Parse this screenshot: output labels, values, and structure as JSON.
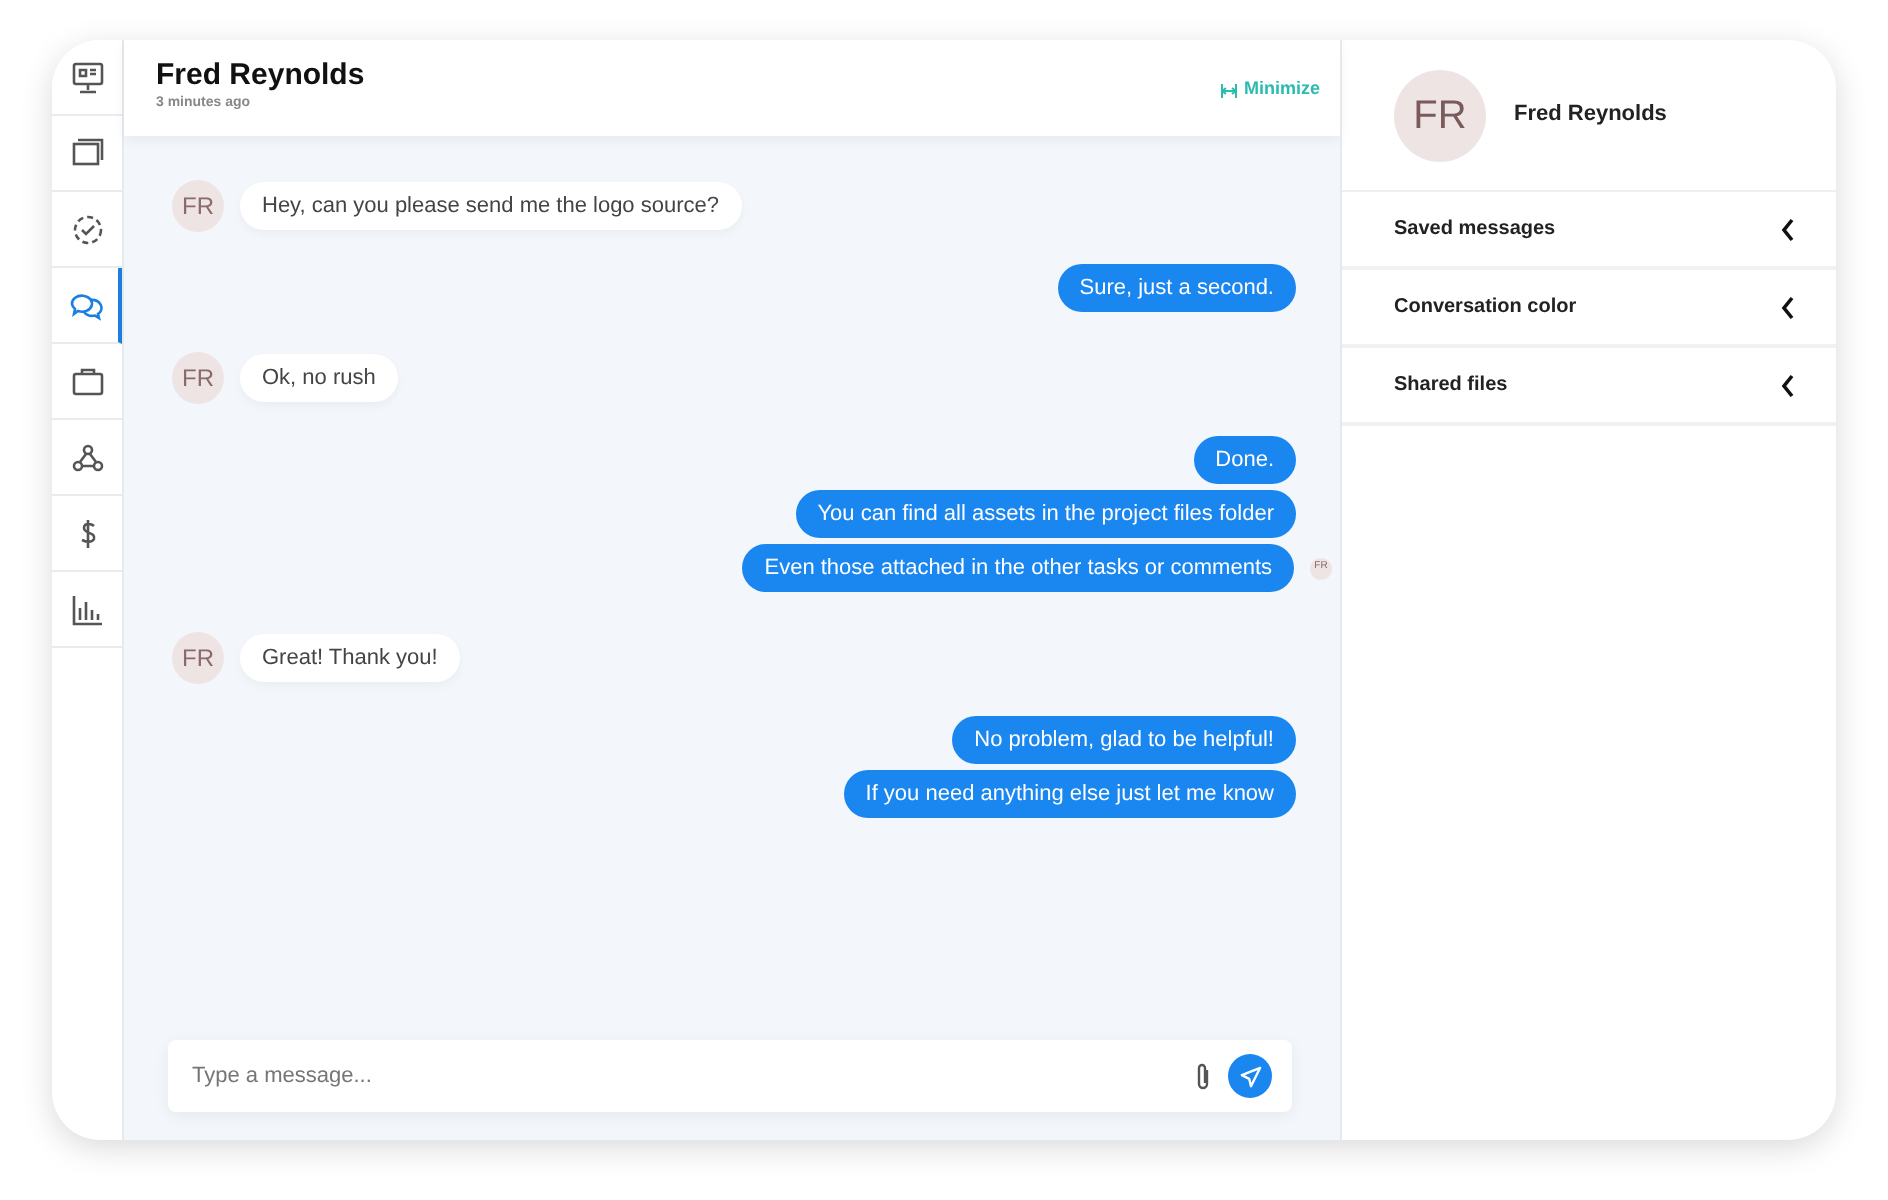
{
  "nav_items": [
    {
      "selected": false
    },
    {
      "selected": false
    },
    {
      "selected": false
    },
    {
      "selected": true
    },
    {
      "selected": false
    },
    {
      "selected": false
    },
    {
      "selected": false
    },
    {
      "selected": false
    }
  ],
  "chat": {
    "title": "Fred Reynolds",
    "subtitle": "3 minutes ago",
    "minimize": "Minimize"
  },
  "message_groups": [
    {
      "kind": "them",
      "avatar": "FR",
      "messages": [
        "Hey, can you please send me the logo source?"
      ]
    },
    {
      "kind": "me",
      "messages": [
        "Sure, just a second."
      ]
    },
    {
      "kind": "them",
      "avatar": "FR",
      "messages": [
        "Ok, no rush"
      ]
    },
    {
      "kind": "me",
      "messages": [
        "Done.",
        "You can find all assets in the project files folder",
        "Even those attached in the other tasks or comments"
      ],
      "read_avatar": "FR"
    },
    {
      "kind": "them",
      "avatar": "FR",
      "messages": [
        "Great! Thank you!"
      ]
    },
    {
      "kind": "me",
      "messages": [
        "No problem, glad to be helpful!",
        "If you need anything else just let me know"
      ]
    }
  ],
  "composer": {
    "placeholder": "Type a message..."
  },
  "profile": {
    "avatar": "FR",
    "name": "Fred Reynolds"
  },
  "sections": [
    {
      "label": "Saved messages",
      "expanded": false
    },
    {
      "label": "Conversation color",
      "expanded": false
    },
    {
      "label": "Shared files",
      "expanded": false
    }
  ]
}
